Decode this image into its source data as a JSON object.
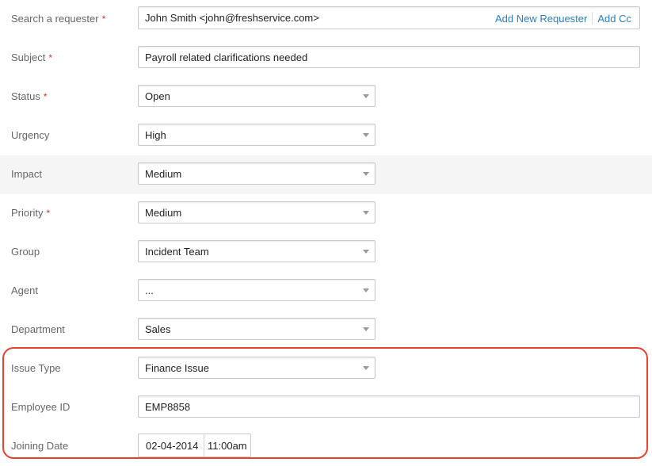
{
  "requester": {
    "label": "Search a requester",
    "required_mark": "*",
    "value": "John Smith <john@freshservice.com>",
    "add_new_link": "Add New Requester",
    "add_cc_link": "Add Cc"
  },
  "subject": {
    "label": "Subject",
    "required_mark": "*",
    "value": "Payroll related clarifications needed"
  },
  "status": {
    "label": "Status",
    "required_mark": "*",
    "value": "Open"
  },
  "urgency": {
    "label": "Urgency",
    "value": "High"
  },
  "impact": {
    "label": "Impact",
    "value": "Medium"
  },
  "priority": {
    "label": "Priority",
    "required_mark": "*",
    "value": "Medium"
  },
  "group": {
    "label": "Group",
    "value": "Incident Team"
  },
  "agent": {
    "label": "Agent",
    "value": "..."
  },
  "department": {
    "label": "Department",
    "value": "Sales"
  },
  "issue_type": {
    "label": "Issue Type",
    "value": "Finance Issue"
  },
  "employee_id": {
    "label": "Employee ID",
    "value": "EMP8858"
  },
  "joining_date": {
    "label": "Joining Date",
    "date": "02-04-2014",
    "time": "11:00am"
  },
  "colors": {
    "link": "#2b7ec1",
    "required": "#c0392b",
    "highlight": "#e8412c"
  }
}
